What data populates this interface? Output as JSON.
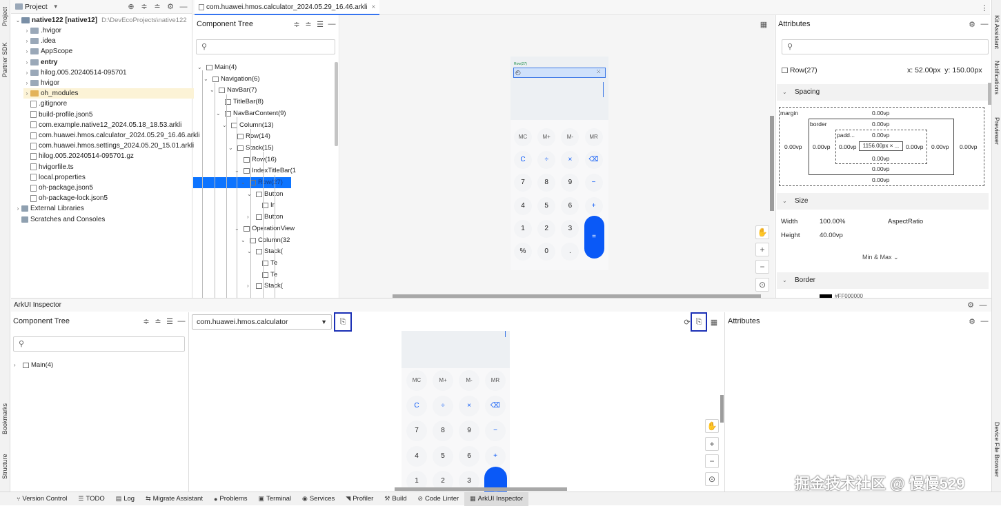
{
  "left_strip": {
    "project": "Project",
    "partner_sdk": "Partner SDK",
    "bookmarks": "Bookmarks",
    "structure": "Structure"
  },
  "right_strip": {
    "kit_assistant": "Kit Assistant",
    "notifications": "Notifications",
    "previewer": "Previewer",
    "device_file_browser": "Device File Browser"
  },
  "project": {
    "title": "Project",
    "root_name": "native122 [native12]",
    "root_path": "D:\\DevEcoProjects\\native122",
    "items": [
      {
        "label": ".hvigor",
        "kind": "folder"
      },
      {
        "label": ".idea",
        "kind": "folder"
      },
      {
        "label": "AppScope",
        "kind": "folder"
      },
      {
        "label": "entry",
        "kind": "folder"
      },
      {
        "label": "hilog.005.20240514-095701",
        "kind": "folder"
      },
      {
        "label": "hvigor",
        "kind": "folder"
      },
      {
        "label": "oh_modules",
        "kind": "folder"
      },
      {
        "label": ".gitignore",
        "kind": "file"
      },
      {
        "label": "build-profile.json5",
        "kind": "file"
      },
      {
        "label": "com.example.native12_2024.05.18_18.53.arkli",
        "kind": "file"
      },
      {
        "label": "com.huawei.hmos.calculator_2024.05.29_16.46.arkli",
        "kind": "file"
      },
      {
        "label": "com.huawei.hmos.settings_2024.05.20_15.01.arkli",
        "kind": "file"
      },
      {
        "label": "hilog.005.20240514-095701.gz",
        "kind": "file"
      },
      {
        "label": "hvigorfile.ts",
        "kind": "file"
      },
      {
        "label": "local.properties",
        "kind": "file"
      },
      {
        "label": "oh-package.json5",
        "kind": "file"
      },
      {
        "label": "oh-package-lock.json5",
        "kind": "file"
      },
      {
        "label": "External Libraries",
        "kind": "lib"
      },
      {
        "label": "Scratches and Consoles",
        "kind": "lib"
      }
    ]
  },
  "editor_tab": {
    "label": "com.huawei.hmos.calculator_2024.05.29_16.46.arkli"
  },
  "component_tree_top": {
    "title": "Component Tree",
    "nodes": [
      {
        "label": "Main(4)"
      },
      {
        "label": "Navigation(6)"
      },
      {
        "label": "NavBar(7)"
      },
      {
        "label": "TitleBar(8)"
      },
      {
        "label": "NavBarContent(9)"
      },
      {
        "label": "Column(13)"
      },
      {
        "label": "Row(14)"
      },
      {
        "label": "Stack(15)"
      },
      {
        "label": "Row(16)"
      },
      {
        "label": "IndexTitleBar(1"
      },
      {
        "label": "Row(27)"
      },
      {
        "label": "Button"
      },
      {
        "label": "Ir"
      },
      {
        "label": "Button"
      },
      {
        "label": "OperationView"
      },
      {
        "label": "Column(32"
      },
      {
        "label": "Stack("
      },
      {
        "label": "Te"
      },
      {
        "label": "Te"
      },
      {
        "label": "Stack("
      }
    ]
  },
  "calc_keys": {
    "mem": [
      "MC",
      "M+",
      "M-",
      "MR"
    ],
    "r1": [
      "C",
      "÷",
      "×",
      "⌫"
    ],
    "r2": [
      "7",
      "8",
      "9",
      "−"
    ],
    "r3": [
      "4",
      "5",
      "6",
      "+"
    ],
    "r4": [
      "1",
      "2",
      "3"
    ],
    "r5": [
      "%",
      "0",
      "."
    ],
    "equals": "=",
    "row_tag": "Row(27)"
  },
  "attributes_top": {
    "title": "Attributes",
    "selected": "Row(27)",
    "pos_x": "x: 52.00px",
    "pos_y": "y: 150.00px",
    "spacing": "Spacing",
    "margin": "margin",
    "border": "border",
    "padding": "padd...",
    "content": "1156.00px × ...",
    "zero": "0.00vp",
    "size": "Size",
    "width_label": "Width",
    "width_val": "100.00%",
    "aspect": "AspectRatio",
    "height_label": "Height",
    "height_val": "40.00vp",
    "minmax": "Min & Max",
    "border_section": "Border",
    "border_val": "#FF000000"
  },
  "inspector": {
    "title": "ArkUI Inspector",
    "tree_title": "Component Tree",
    "node": "Main(4)",
    "process": "com.huawei.hmos.calculator",
    "attributes": "Attributes"
  },
  "watermark": "掘金技术社区 @ 慢慢529",
  "bottom_bar": [
    {
      "label": "Version Control",
      "icon": "branch-icon"
    },
    {
      "label": "TODO",
      "icon": "list-icon"
    },
    {
      "label": "Log",
      "icon": "log-icon"
    },
    {
      "label": "Migrate Assistant",
      "icon": "migrate-icon"
    },
    {
      "label": "Problems",
      "icon": "problems-icon"
    },
    {
      "label": "Terminal",
      "icon": "terminal-icon"
    },
    {
      "label": "Services",
      "icon": "services-icon"
    },
    {
      "label": "Profiler",
      "icon": "profiler-icon"
    },
    {
      "label": "Build",
      "icon": "build-icon"
    },
    {
      "label": "Code Linter",
      "icon": "linter-icon"
    },
    {
      "label": "ArkUI Inspector",
      "icon": "inspector-icon"
    }
  ],
  "colors": {
    "accent": "#0a59f7",
    "selection": "#0d74ff",
    "highlight_box": "#1a2fb5"
  }
}
